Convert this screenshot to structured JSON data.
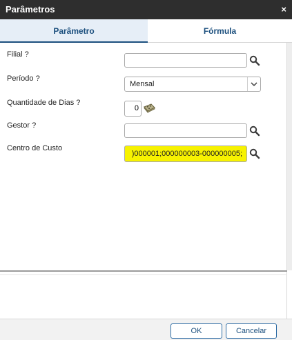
{
  "window": {
    "title": "Parâmetros",
    "close_label": "×"
  },
  "tabs": [
    {
      "label": "Parâmetro",
      "active": true
    },
    {
      "label": "Fórmula",
      "active": false
    }
  ],
  "fields": {
    "filial": {
      "label": "Filial ?",
      "value": ""
    },
    "periodo": {
      "label": "Período ?",
      "value": "Mensal"
    },
    "quantidade_dias": {
      "label": "Quantidade de Dias ?",
      "value": "0"
    },
    "gestor": {
      "label": "Gestor ?",
      "value": ""
    },
    "centro_custo": {
      "label": "Centro de Custo",
      "value": ")000001;000000003-000000005;"
    }
  },
  "buttons": {
    "ok": "OK",
    "cancel": "Cancelar"
  },
  "colors": {
    "accent": "#1a4e7d",
    "highlight": "#f7f200",
    "titlebar": "#2e2e2e"
  },
  "icons": {
    "search": "search-icon",
    "calculator": "calculator-icon",
    "dropdown": "chevron-down-icon",
    "close": "close-icon"
  }
}
